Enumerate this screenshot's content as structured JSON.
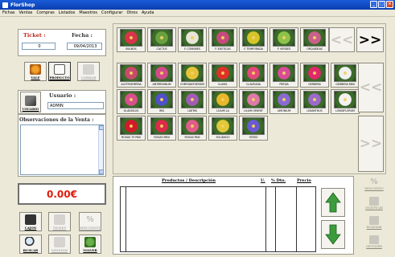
{
  "window": {
    "title": "FlorShop"
  },
  "menu": [
    "Fichas",
    "Ventas",
    "Compras",
    "Listados",
    "Maestros",
    "Configurar",
    "Otros",
    "Ayuda"
  ],
  "ticket": {
    "ticket_label": "Ticket :",
    "ticket_value": "0",
    "fecha_label": "Fecha :",
    "fecha_value": "09/04/2013"
  },
  "left_tools": {
    "vale": "VALE",
    "producto": "PRODUCTO",
    "cobrar": "COBRAR"
  },
  "user": {
    "button": "USUARIO",
    "label": "Usuario :",
    "value": "ADMIN"
  },
  "observaciones": {
    "label": "Observaciones de la Venta :"
  },
  "total": {
    "value": "0.00€"
  },
  "bottom_tools": {
    "cajon": "CAJON",
    "ticket": "TICKET",
    "descuento": "DESCUENTO",
    "buscar": "BUSCAR",
    "gestion": "GESTION",
    "volver": "VOLVER"
  },
  "categories": [
    {
      "label": "BULBOS",
      "color": "#d8344a"
    },
    {
      "label": "CACTUS",
      "color": "#6aa040"
    },
    {
      "label": "F. COMUNES",
      "color": "#e8e4d8"
    },
    {
      "label": "F. EXOTICAS",
      "color": "#c64a7c"
    },
    {
      "label": "F. TEMPORADA",
      "color": "#d6c42a"
    },
    {
      "label": "F. VERDES",
      "color": "#8ec24a"
    },
    {
      "label": "ORQUIDEAS",
      "color": "#c8608a"
    }
  ],
  "products": [
    {
      "label": "ALSTROEMERIA",
      "color": "#c84a6c"
    },
    {
      "label": "ANTIRRHINUM",
      "color": "#d24a8c"
    },
    {
      "label": "CHRYSANTHEMUM",
      "color": "#e6c43a"
    },
    {
      "label": "CLAVEL",
      "color": "#e0302a"
    },
    {
      "label": "CLAVELINA",
      "color": "#e2487a"
    },
    {
      "label": "FRESIA",
      "color": "#d84c9a"
    },
    {
      "label": "GERBERA",
      "color": "#e0286a"
    },
    {
      "label": "GERBERA MINI",
      "color": "#f0f0f0"
    },
    {
      "label": "GLADIOLUS",
      "color": "#d8508e"
    },
    {
      "label": "IRIS",
      "color": "#5050c8"
    },
    {
      "label": "LIATRIS",
      "color": "#a25cb4"
    },
    {
      "label": "LILIUM LA",
      "color": "#e8b82a"
    },
    {
      "label": "LILIUM ORIENT",
      "color": "#e078a8"
    },
    {
      "label": "LIMONIUM",
      "color": "#8a6ad0"
    },
    {
      "label": "LISIANTHUS",
      "color": "#9a6ac8"
    },
    {
      "label": "LONGIFLORUM",
      "color": "#f2f2f2"
    },
    {
      "label": "ROSAS 70 PAIS",
      "color": "#d21a2a"
    },
    {
      "label": "ROSAS MINI",
      "color": "#dc2a4a"
    },
    {
      "label": "ROSAS PAIS",
      "color": "#e05c8a"
    },
    {
      "label": "SOLIDAGO",
      "color": "#e0c83a"
    },
    {
      "label": "STATIZ",
      "color": "#6a5ad0"
    }
  ],
  "nav": {
    "prev": "<<",
    "next": ">>"
  },
  "table": {
    "col_desc": "Productos / Descripción",
    "col_u": "U.",
    "col_dto": "% Dto.",
    "col_precio": "Precio"
  },
  "side_actions": {
    "descuento": "DESCUENTO",
    "modificar": "MODIFICAR",
    "eliminar": "ELIMINAR",
    "devolver": "DEVOLVER"
  }
}
